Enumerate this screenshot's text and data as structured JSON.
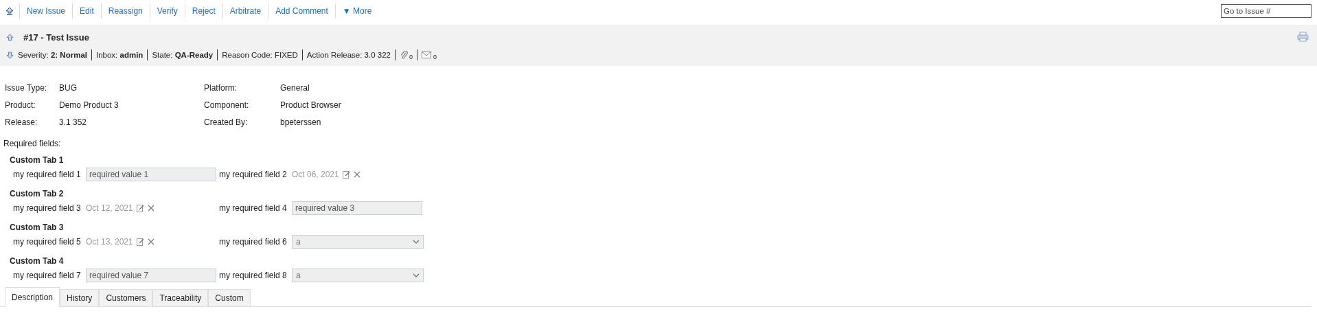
{
  "toolbar": {
    "actions": [
      {
        "label": "New Issue"
      },
      {
        "label": "Edit"
      },
      {
        "label": "Reassign"
      },
      {
        "label": "Verify"
      },
      {
        "label": "Reject"
      },
      {
        "label": "Arbitrate"
      },
      {
        "label": "Add Comment"
      },
      {
        "label": "More",
        "kind": "menu",
        "caret": "▼"
      }
    ],
    "goto": {
      "placeholder": "Go to Issue #"
    }
  },
  "header": {
    "title": "#17 - Test Issue",
    "meta": [
      {
        "label": "Severity:",
        "value": "2: Normal",
        "bold": true
      },
      {
        "label": "Inbox:",
        "value": "admin",
        "bold": true
      },
      {
        "label": "State:",
        "value": "QA-Ready",
        "bold": true
      },
      {
        "label": "Reason Code:",
        "value": "FIXED",
        "bold": false
      },
      {
        "label": "Action Release:",
        "value": "3.0 322",
        "bold": false
      }
    ],
    "attachments": "0",
    "emails": "0"
  },
  "details": [
    {
      "label": "Issue Type:",
      "value": "BUG"
    },
    {
      "label": "Platform:",
      "value": "General"
    },
    {
      "label": "Product:",
      "value": "Demo Product 3"
    },
    {
      "label": "Component:",
      "value": "Product Browser"
    },
    {
      "label": "Release:",
      "value": "3.1 352"
    },
    {
      "label": "Created By:",
      "value": "bpeterssen"
    }
  ],
  "required": {
    "title": "Required fields:",
    "groups": [
      {
        "title": "Custom Tab 1",
        "fields": [
          {
            "label": "my required field 1",
            "kind": "text",
            "value": "required value 1"
          },
          {
            "label": "my required field 2",
            "kind": "date",
            "value": "Oct 06, 2021"
          }
        ]
      },
      {
        "title": "Custom Tab 2",
        "fields": [
          {
            "label": "my required field 3",
            "kind": "date",
            "value": "Oct 12, 2021"
          },
          {
            "label": "my required field 4",
            "kind": "text",
            "value": "required value 3"
          }
        ]
      },
      {
        "title": "Custom Tab 3",
        "fields": [
          {
            "label": "my required field 5",
            "kind": "date",
            "value": "Oct 13, 2021"
          },
          {
            "label": "my required field 6",
            "kind": "select",
            "value": "a"
          }
        ]
      },
      {
        "title": "Custom Tab 4",
        "fields": [
          {
            "label": "my required field 7",
            "kind": "text",
            "value": "required value 7"
          },
          {
            "label": "my required field 8",
            "kind": "select",
            "value": "a"
          }
        ]
      }
    ]
  },
  "tabs": [
    {
      "label": "Description",
      "selected": true
    },
    {
      "label": "History",
      "selected": false
    },
    {
      "label": "Customers",
      "selected": false
    },
    {
      "label": "Traceability",
      "selected": false
    },
    {
      "label": "Custom",
      "selected": false
    }
  ]
}
